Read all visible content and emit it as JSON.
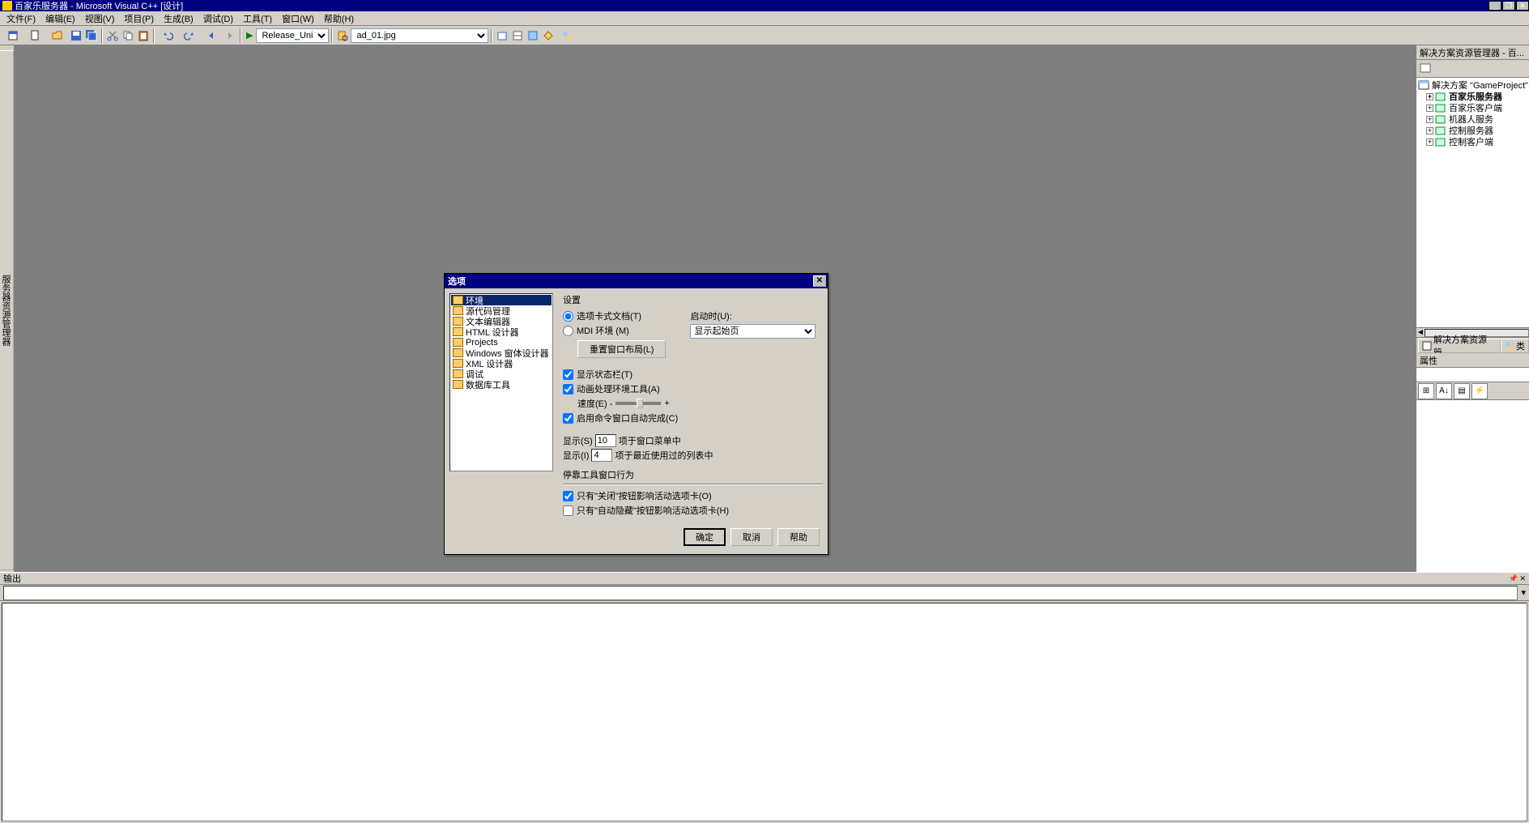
{
  "titlebar": {
    "text": "百家乐服务器 - Microsoft Visual C++ [设计]"
  },
  "menu": {
    "items": [
      "文件(F)",
      "编辑(E)",
      "视图(V)",
      "项目(P)",
      "生成(B)",
      "调试(D)",
      "工具(T)",
      "窗口(W)",
      "帮助(H)"
    ]
  },
  "toolbar": {
    "config": "Release_Unicode",
    "find": "ad_01.jpg"
  },
  "left_sidebar": {
    "tab1": "服务器资源管理器",
    "tab2": "✕"
  },
  "solution_explorer": {
    "title": "解决方案资源管理器 - 百...",
    "root": "解决方案 \"GameProject\" (",
    "nodes": [
      "百家乐服务器",
      "百家乐客户端",
      "机器人服务",
      "控制服务器",
      "控制客户端"
    ],
    "tab_label": "解决方案资源管..."
  },
  "properties": {
    "title": "属性"
  },
  "output": {
    "title": "输出"
  },
  "dialog": {
    "title": "选项",
    "tree": [
      "环境",
      "源代码管理",
      "文本编辑器",
      "HTML 设计器",
      "Projects",
      "Windows 窗体设计器",
      "XML 设计器",
      "调试",
      "数据库工具"
    ],
    "settings_label": "设置",
    "radio_tabbed": "选项卡式文档(T)",
    "radio_mdi": "MDI 环境 (M)",
    "startup_label": "启动时(U):",
    "startup_value": "显示起始页",
    "reset_layout_btn": "重置窗口布局(L)",
    "chk_statusbar": "显示状态栏(T)",
    "chk_animate": "动画处理环境工具(A)",
    "speed_label": "速度(E) -",
    "speed_plus": "+",
    "chk_autocomplete": "启用命令窗口自动完成(C)",
    "show_label1": "显示(S)",
    "show_val1": "10",
    "show_suffix1": "项于窗口菜单中",
    "show_label2": "显示(I)",
    "show_val2": "4",
    "show_suffix2": "项于最近使用过的列表中",
    "docked_label": "停靠工具窗口行为",
    "chk_close": "只有\"关闭\"按钮影响活动选项卡(O)",
    "chk_autohide": "只有\"自动隐藏\"按钮影响活动选项卡(H)",
    "btn_ok": "确定",
    "btn_cancel": "取消",
    "btn_help": "帮助"
  }
}
